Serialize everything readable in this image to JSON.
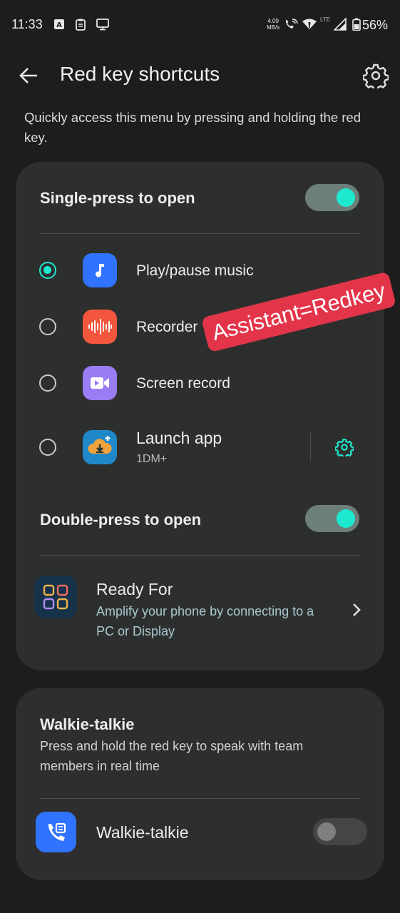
{
  "status_bar": {
    "time": "11:33",
    "net_speed_value": "4.09",
    "net_speed_unit": "MB/s",
    "network": "LTE",
    "battery": "56%"
  },
  "header": {
    "title": "Red key shortcuts"
  },
  "description": "Quickly access this menu by pressing and holding the red key.",
  "single_press": {
    "title": "Single-press to open",
    "enabled": true,
    "options": [
      {
        "label": "Play/pause music",
        "selected": true,
        "icon": "music-note-icon",
        "color": "#2f73ff"
      },
      {
        "label": "Recorder",
        "selected": false,
        "icon": "waveform-icon",
        "color": "#f2573e"
      },
      {
        "label": "Screen record",
        "selected": false,
        "icon": "video-camera-icon",
        "color": "#9a7cf4"
      },
      {
        "label": "Launch app",
        "sublabel": "1DM+",
        "selected": false,
        "icon": "download-cloud-icon",
        "color": "#1e88c8"
      }
    ]
  },
  "double_press": {
    "title": "Double-press to open",
    "enabled": true,
    "ready_for": {
      "title": "Ready For",
      "description": "Amplify your phone by connecting to a PC or Display"
    }
  },
  "walkie_talkie": {
    "title": "Walkie-talkie",
    "description": "Press and hold the red key to speak with team members in real time",
    "item_label": "Walkie-talkie",
    "enabled": false
  },
  "overlay_stamp": "Assistant=Redkey",
  "colors": {
    "accent": "#1de9d0",
    "card": "#2d2f2e",
    "background": "#1c1d1c",
    "stamp": "#e3354a"
  }
}
